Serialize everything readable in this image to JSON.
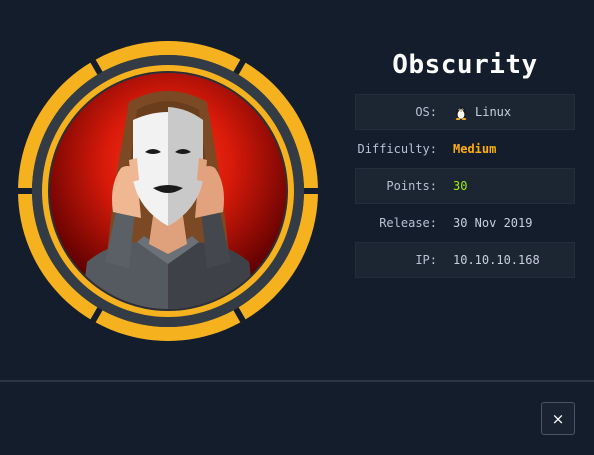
{
  "machine": {
    "name": "Obscurity",
    "avatar_icon": "masked-person-badge"
  },
  "info": [
    {
      "label": "OS:",
      "value": "Linux",
      "icon": "tux-icon"
    },
    {
      "label": "Difficulty:",
      "value": "Medium"
    },
    {
      "label": "Points:",
      "value": "30"
    },
    {
      "label": "Release:",
      "value": "30 Nov 2019"
    },
    {
      "label": "IP:",
      "value": "10.10.10.168"
    }
  ],
  "footer": {
    "close_label": "×"
  },
  "colors": {
    "background": "#141d2b",
    "badge_ring": "#f5b21e",
    "badge_inner": "#c81808",
    "difficulty_medium": "#ffaf00",
    "points": "#9fef00"
  }
}
